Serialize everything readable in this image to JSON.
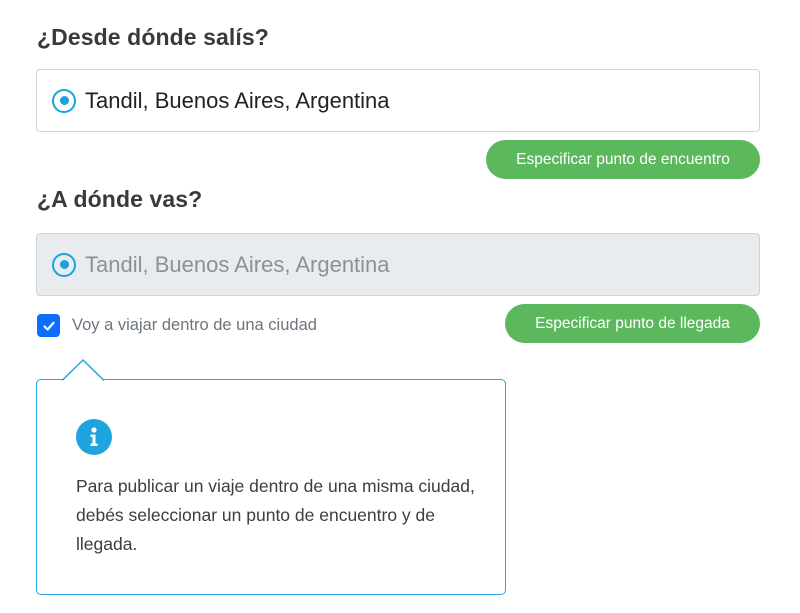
{
  "origin": {
    "heading": "¿Desde dónde salís?",
    "value": "Tandil, Buenos Aires, Argentina",
    "button_label": "Especificar punto de encuentro"
  },
  "destination": {
    "heading": "¿A dónde vas?",
    "value": "Tandil, Buenos Aires, Argentina",
    "button_label": "Especificar punto de llegada",
    "disabled": true
  },
  "within_city": {
    "checked": true,
    "label": "Voy a viajar dentro de una ciudad"
  },
  "info": {
    "icon": "info-icon",
    "text": "Para publicar un viaje dentro de una misma ciudad, debés seleccionar un punto de encuentro y de llegada."
  },
  "colors": {
    "accent_blue": "#1ba1dc",
    "button_green": "#5cb85c",
    "checkbox_blue": "#0d6efd"
  }
}
